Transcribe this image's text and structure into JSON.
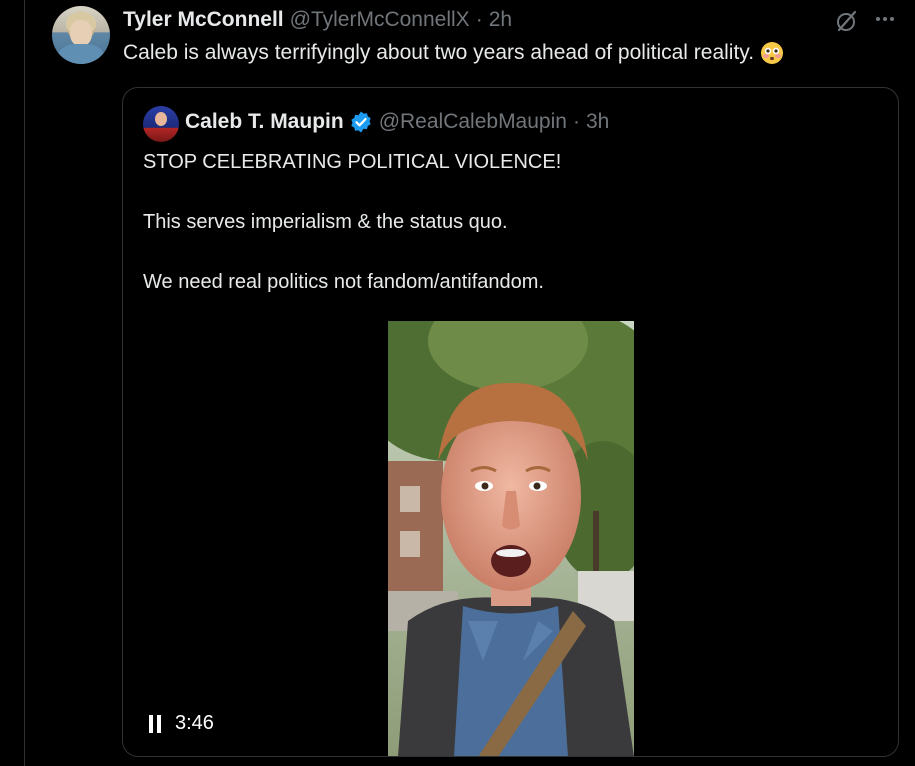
{
  "tweet": {
    "author_name": "Tyler McConnell",
    "author_handle": "@TylerMcConnellX",
    "separator": "·",
    "time": "2h",
    "text": "Caleb is always terrifyingly about two years ahead of political reality.",
    "emoji": "flushed-face-emoji"
  },
  "quoted_tweet": {
    "author_name": "Caleb T. Maupin",
    "author_handle": "@RealCalebMaupin",
    "separator": "·",
    "time": "3h",
    "verified": true,
    "lines": [
      "STOP CELEBRATING POLITICAL VIOLENCE!",
      "This serves imperialism & the status quo.",
      "We need real politics not fandom/antifandom."
    ],
    "video": {
      "state": "playing",
      "duration": "3:46"
    }
  },
  "colors": {
    "background": "#000000",
    "text_primary": "#e7e9ea",
    "text_secondary": "#71767b",
    "border": "#2f3336",
    "verified_blue": "#1d9bf0"
  },
  "icons": [
    "grok-icon",
    "more-icon",
    "verified-icon",
    "pause-icon",
    "flushed-face-emoji"
  ]
}
